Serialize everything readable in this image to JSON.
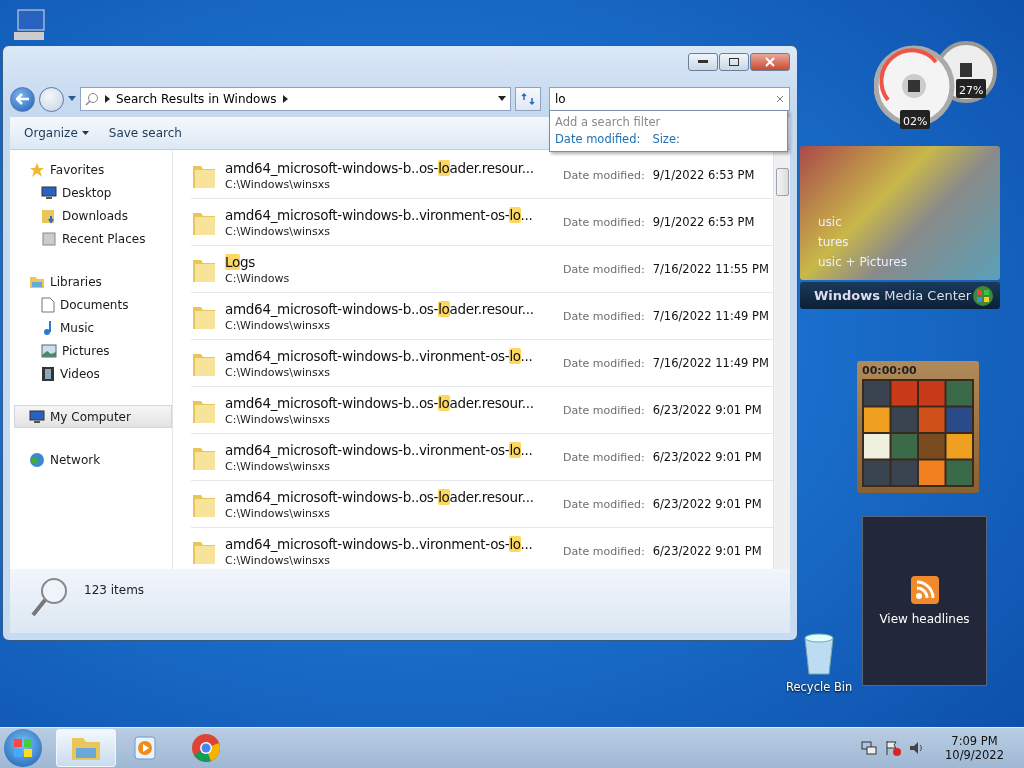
{
  "explorer": {
    "address": "Search Results in Windows",
    "search": {
      "value": "lo",
      "hint": "Add a search filter",
      "filters": [
        "Date modified:",
        "Size:"
      ]
    },
    "toolbar": [
      "Organize",
      "Save search"
    ],
    "nav": [
      {
        "label": "Favorites",
        "kind": "favorites",
        "selected": false,
        "children": [
          {
            "label": "Desktop",
            "kind": "desktop",
            "selected": false
          },
          {
            "label": "Downloads",
            "kind": "downloads",
            "selected": false
          },
          {
            "label": "Recent Places",
            "kind": "recent",
            "selected": false
          }
        ]
      },
      {
        "label": "Libraries",
        "kind": "libraries",
        "selected": false,
        "children": [
          {
            "label": "Documents",
            "kind": "documents",
            "selected": false
          },
          {
            "label": "Music",
            "kind": "music",
            "selected": false
          },
          {
            "label": "Pictures",
            "kind": "pictures",
            "selected": false
          },
          {
            "label": "Videos",
            "kind": "videos",
            "selected": false
          }
        ]
      },
      {
        "label": "My Computer",
        "kind": "computer",
        "selected": true
      },
      {
        "label": "Network",
        "kind": "network",
        "selected": false
      }
    ],
    "files": [
      {
        "prefix": "amd64_microsoft-windows-b..os-",
        "match": "lo",
        "suffix": "ader.resour...",
        "path": "C:\\Windows\\winsxs",
        "date_label": "Date modified:",
        "date": "9/1/2022 6:53 PM"
      },
      {
        "prefix": "amd64_microsoft-windows-b..vironment-os-",
        "match": "lo",
        "suffix": "...",
        "path": "C:\\Windows\\winsxs",
        "date_label": "Date modified:",
        "date": "9/1/2022 6:53 PM"
      },
      {
        "match": "Lo",
        "suffix": "gs",
        "path": "C:\\Windows",
        "date_label": "Date modified:",
        "date": "7/16/2022 11:55 PM"
      },
      {
        "prefix": "amd64_microsoft-windows-b..os-",
        "match": "lo",
        "suffix": "ader.resour...",
        "path": "C:\\Windows\\winsxs",
        "date_label": "Date modified:",
        "date": "7/16/2022 11:49 PM"
      },
      {
        "prefix": "amd64_microsoft-windows-b..vironment-os-",
        "match": "lo",
        "suffix": "...",
        "path": "C:\\Windows\\winsxs",
        "date_label": "Date modified:",
        "date": "7/16/2022 11:49 PM"
      },
      {
        "prefix": "amd64_microsoft-windows-b..os-",
        "match": "lo",
        "suffix": "ader.resour...",
        "path": "C:\\Windows\\winsxs",
        "date_label": "Date modified:",
        "date": "6/23/2022 9:01 PM"
      },
      {
        "prefix": "amd64_microsoft-windows-b..vironment-os-",
        "match": "lo",
        "suffix": "...",
        "path": "C:\\Windows\\winsxs",
        "date_label": "Date modified:",
        "date": "6/23/2022 9:01 PM"
      },
      {
        "prefix": "amd64_microsoft-windows-b..os-",
        "match": "lo",
        "suffix": "ader.resour...",
        "path": "C:\\Windows\\winsxs",
        "date_label": "Date modified:",
        "date": "6/23/2022 9:01 PM"
      },
      {
        "prefix": "amd64_microsoft-windows-b..vironment-os-",
        "match": "lo",
        "suffix": "...",
        "path": "C:\\Windows\\winsxs",
        "date_label": "Date modified:",
        "date": "6/23/2022 9:01 PM"
      }
    ],
    "status": "123 items"
  },
  "gadgets": {
    "cpu": {
      "main": "02%",
      "memory": "27%"
    },
    "media_center": {
      "menu": [
        "usic",
        "tures",
        "usic + Pictures"
      ],
      "title": "**Windows** Media Center"
    },
    "puzzle": {
      "timer": "00:00:00"
    },
    "feed": {
      "label": "View headlines"
    }
  },
  "desktop_icons": [
    {
      "label": "Recycle Bin"
    }
  ],
  "taskbar": {
    "items": [
      {
        "kind": "explorer",
        "selected": true
      },
      {
        "kind": "media",
        "selected": false
      },
      {
        "kind": "browser",
        "selected": false
      }
    ],
    "time": "7:09 PM",
    "date": "10/9/2022"
  }
}
